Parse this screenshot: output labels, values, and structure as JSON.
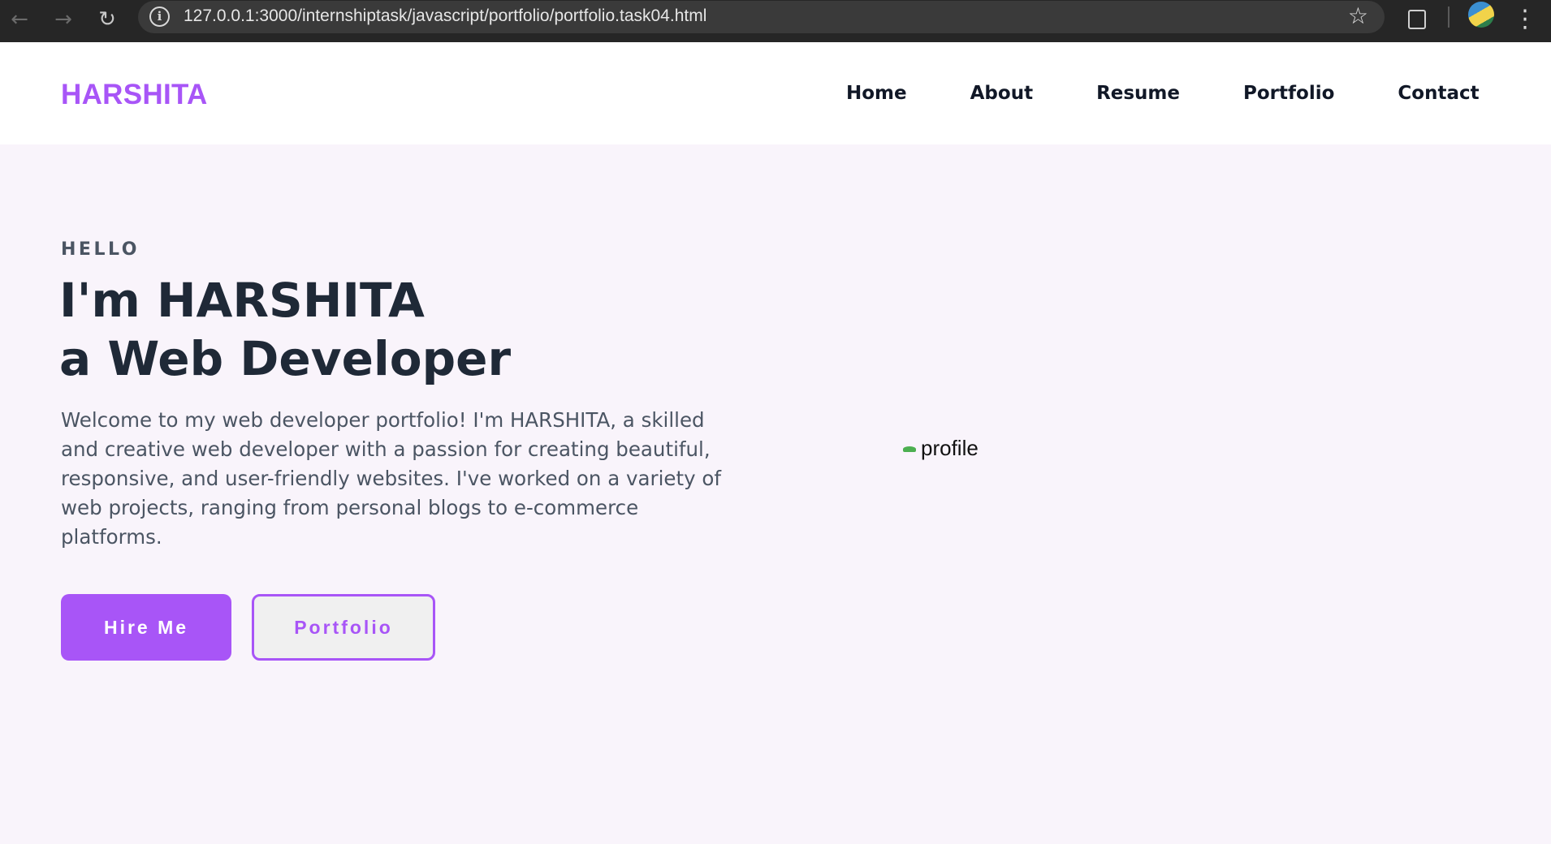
{
  "browser": {
    "url": "127.0.0.1:3000/internshiptask/javascript/portfolio/portfolio.task04.html",
    "icons": [
      "back-arrow-icon",
      "forward-arrow-icon",
      "reload-icon",
      "site-info-icon",
      "bookmark-star-icon",
      "extensions-icon",
      "profile-avatar-icon",
      "more-menu-icon"
    ]
  },
  "header": {
    "logo": "HARSHITA",
    "nav": [
      "Home",
      "About",
      "Resume",
      "Portfolio",
      "Contact"
    ]
  },
  "hero": {
    "eyebrow": "HELLO",
    "line1_prefix": "I'm ",
    "line1_name": "HARSHITA",
    "line2_article": "a",
    "line2_role": " Web Developer",
    "intro": "Welcome to my web developer portfolio! I'm HARSHITA, a skilled and creative web developer with a passion for creating beautiful, responsive, and user-friendly websites. I've worked on a variety of web projects, ranging from personal blogs to e-commerce platforms.",
    "buttons": {
      "hire": "Hire Me",
      "portfolio": "Portfolio"
    },
    "image_alt": "profile"
  },
  "colors": {
    "accent": "#a855f7",
    "chrome_bg": "#262626",
    "hero_bg": "#f9f4fb",
    "text_dark": "#1f2937",
    "text_muted": "#4b5563"
  }
}
